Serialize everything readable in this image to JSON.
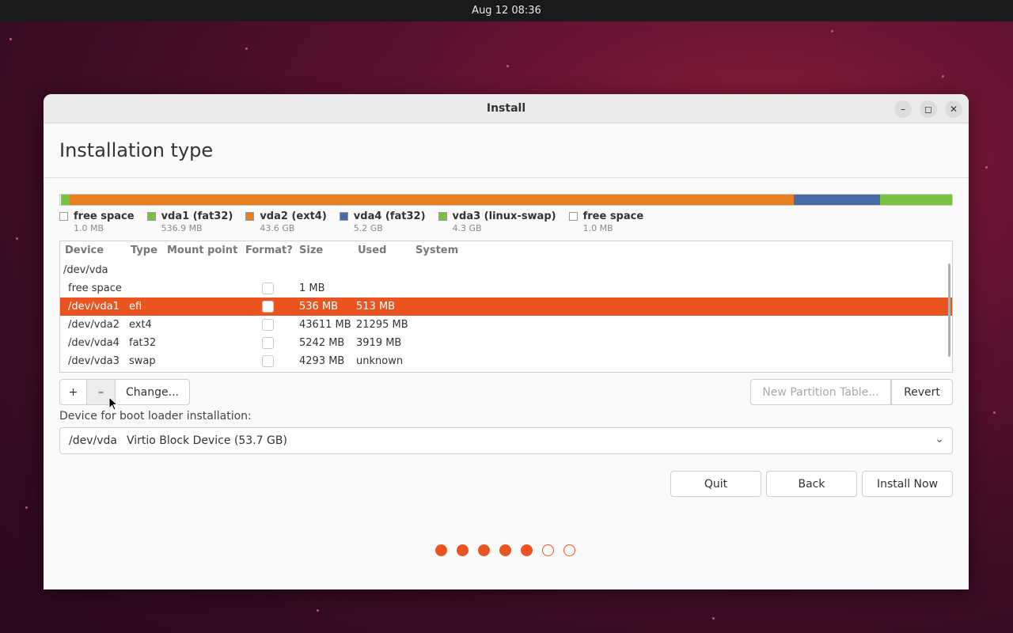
{
  "topbar": {
    "datetime": "Aug 12  08:36"
  },
  "window": {
    "title": "Install",
    "minimize_glyph": "–",
    "maximize_glyph": "◻",
    "close_glyph": "✕"
  },
  "page": {
    "heading": "Installation type"
  },
  "colors": {
    "accent": "#e95420",
    "free": "#ffffff",
    "fat32_efi": "#7cc242",
    "ext4": "#e9801f",
    "vda4_fat32": "#4a6aa5",
    "swap": "#7cc242"
  },
  "partition_bar": [
    {
      "name": "free space",
      "color": "#ffffff",
      "share": 0.0001
    },
    {
      "name": "vda1",
      "color": "#7cc242",
      "share": 0.01
    },
    {
      "name": "vda2",
      "color": "#e9801f",
      "share": 0.812
    },
    {
      "name": "vda4",
      "color": "#4a6aa5",
      "share": 0.097
    },
    {
      "name": "vda3",
      "color": "#7cc242",
      "share": 0.081
    }
  ],
  "legend": [
    {
      "label": "free space",
      "size": "1.0 MB",
      "color": "#ffffff"
    },
    {
      "label": "vda1 (fat32)",
      "size": "536.9 MB",
      "color": "#7cc242"
    },
    {
      "label": "vda2 (ext4)",
      "size": "43.6 GB",
      "color": "#e9801f"
    },
    {
      "label": "vda4 (fat32)",
      "size": "5.2 GB",
      "color": "#4a6aa5"
    },
    {
      "label": "vda3 (linux-swap)",
      "size": "4.3 GB",
      "color": "#7cc242"
    },
    {
      "label": "free space",
      "size": "1.0 MB",
      "color": "#ffffff"
    }
  ],
  "table": {
    "headers": [
      "Device",
      "Type",
      "Mount point",
      "Format?",
      "Size",
      "Used",
      "System"
    ],
    "group": "/dev/vda",
    "rows": [
      {
        "device": "free space",
        "type": "",
        "mount": "",
        "size": "1 MB",
        "used": "",
        "selected": false
      },
      {
        "device": "/dev/vda1",
        "type": "efi",
        "mount": "",
        "size": "536 MB",
        "used": "513 MB",
        "selected": true
      },
      {
        "device": "/dev/vda2",
        "type": "ext4",
        "mount": "",
        "size": "43611 MB",
        "used": "21295 MB",
        "selected": false
      },
      {
        "device": "/dev/vda4",
        "type": "fat32",
        "mount": "",
        "size": "5242 MB",
        "used": "3919 MB",
        "selected": false
      },
      {
        "device": "/dev/vda3",
        "type": "swap",
        "mount": "",
        "size": "4293 MB",
        "used": "unknown",
        "selected": false
      }
    ]
  },
  "toolbar": {
    "add": "+",
    "remove": "–",
    "change": "Change...",
    "new_table": "New Partition Table...",
    "revert": "Revert"
  },
  "bootloader": {
    "label": "Device for boot loader installation:",
    "device": "/dev/vda",
    "description": "Virtio Block Device (53.7 GB)"
  },
  "actions": {
    "quit": "Quit",
    "back": "Back",
    "install": "Install Now"
  },
  "progress": {
    "total_steps": 7,
    "completed_steps": 5
  }
}
